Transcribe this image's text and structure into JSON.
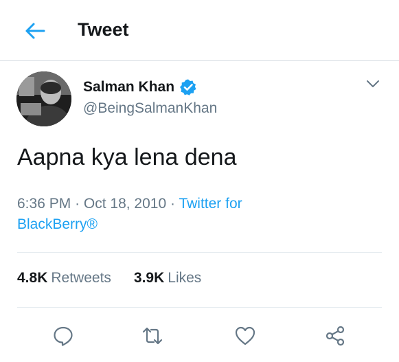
{
  "header": {
    "title": "Tweet"
  },
  "tweet": {
    "author_name": "Salman Khan",
    "author_handle": "@BeingSalmanKhan",
    "text": "Aapna kya lena dena",
    "time": "6:36 PM",
    "date": "Oct 18, 2010",
    "source": "Twitter for BlackBerry®"
  },
  "stats": {
    "retweets_count": "4.8K",
    "retweets_label": "Retweets",
    "likes_count": "3.9K",
    "likes_label": "Likes"
  },
  "icons": {
    "back": "arrow-left-icon",
    "verified": "verified-badge-icon",
    "menu": "chevron-down-icon",
    "reply": "reply-icon",
    "retweet": "retweet-icon",
    "like": "heart-icon",
    "share": "share-icon"
  },
  "colors": {
    "accent": "#1da1f2",
    "secondary_text": "#657786",
    "primary_text": "#14171a"
  }
}
